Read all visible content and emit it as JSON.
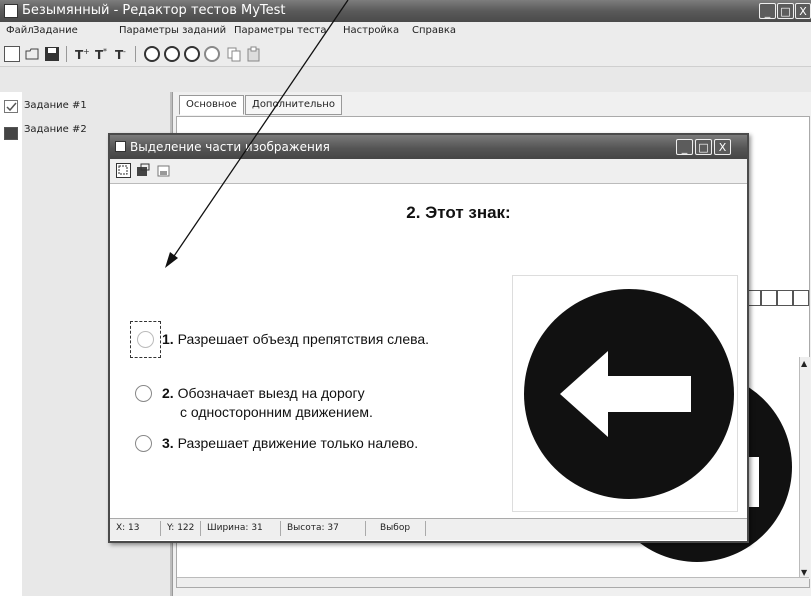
{
  "window": {
    "title": "Безымянный - Редактор тестов MyTest",
    "min_symbol": "_",
    "max_symbol": "□",
    "close_symbol": "X"
  },
  "menu": [
    {
      "label": "Файл"
    },
    {
      "label": "Задание"
    },
    {
      "label": "Параметры заданий"
    },
    {
      "label": "Параметры теста"
    },
    {
      "label": "Настройка"
    },
    {
      "label": "Справка"
    }
  ],
  "tasks": [
    {
      "label": "Задание #1"
    },
    {
      "label": "Задание #2"
    }
  ],
  "tabs": [
    {
      "label": "Основное"
    },
    {
      "label": "Дополнительно"
    }
  ],
  "dialog": {
    "title": "Выделение части изображения",
    "min_symbol": "_",
    "max_symbol": "□",
    "close_symbol": "X",
    "question": "2. Этот знак:",
    "answers": [
      {
        "num": "1.",
        "text": "Разрешает объезд препятствия слева."
      },
      {
        "num": "2.",
        "text": "Обозначает выезд на дорогу",
        "text2": "с односторонним движением."
      },
      {
        "num": "3.",
        "text": "Разрешает движение только налево."
      }
    ],
    "status": {
      "x": "X: 13",
      "y": "Y: 122",
      "width": "Ширина: 31",
      "height": "Высота: 37",
      "mode": "Выбор"
    }
  },
  "colors": {
    "title_bar": "#555555",
    "sign_black": "#111111",
    "sign_white": "#ffffff"
  }
}
